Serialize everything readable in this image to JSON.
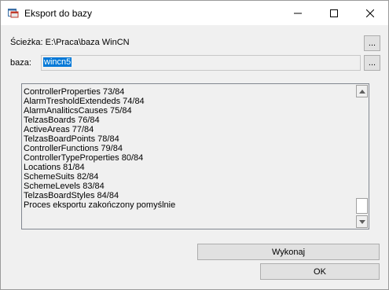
{
  "window": {
    "title": "Eksport do bazy"
  },
  "path": {
    "label": "Ścieżka: E:\\Praca\\baza WinCN",
    "browse_label": "..."
  },
  "database": {
    "label": "baza:",
    "value": "wincn5",
    "browse_label": "..."
  },
  "log": {
    "lines": [
      "ControllerProperties 73/84",
      "AlarmTresholdExtendeds 74/84",
      "AlarmAnaliticsCauses 75/84",
      "TelzasBoards 76/84",
      "ActiveAreas 77/84",
      "TelzasBoardPoints 78/84",
      "ControllerFunctions 79/84",
      "ControllerTypeProperties 80/84",
      "Locations 81/84",
      "SchemeSuits 82/84",
      "SchemeLevels 83/84",
      "TelzasBoardStyles 84/84",
      "Proces eksportu zakończony pomyślnie"
    ]
  },
  "buttons": {
    "execute": "Wykonaj",
    "ok": "OK"
  },
  "icons": {
    "app": "app-window-icon",
    "minimize": "minimize-icon",
    "maximize": "maximize-icon",
    "close": "close-icon"
  }
}
